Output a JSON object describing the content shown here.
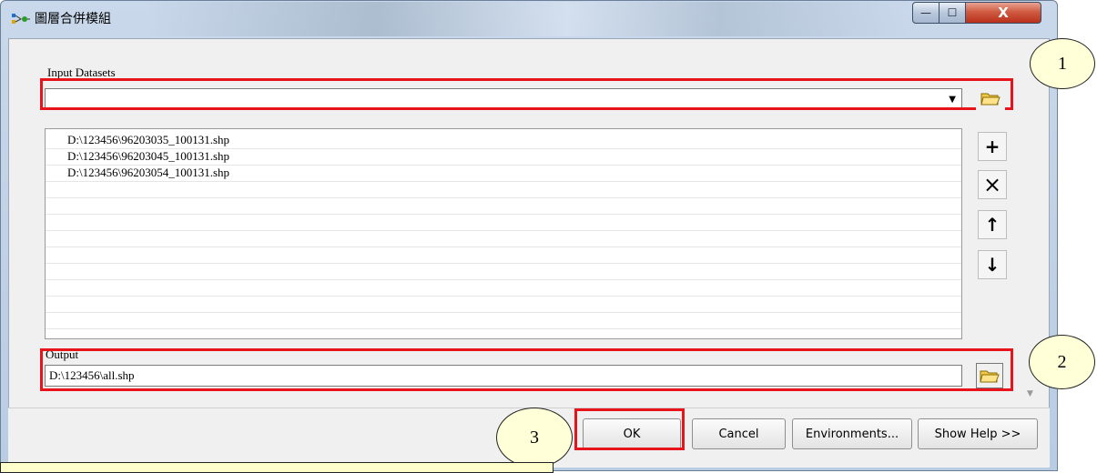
{
  "window": {
    "title": "圖層合併模組",
    "minimize_glyph": "—",
    "maximize_glyph": "☐",
    "close_glyph": "X"
  },
  "input_datasets": {
    "label": "Input Datasets",
    "combo_value": "",
    "dropdown_glyph": "▼",
    "items": [
      "D:\\123456\\96203035_100131.shp",
      "D:\\123456\\96203045_100131.shp",
      "D:\\123456\\96203054_100131.shp"
    ]
  },
  "side_buttons": {
    "add": "+",
    "remove": "×",
    "up": "↑",
    "down": "↓"
  },
  "output": {
    "label": "Output",
    "value": "D:\\123456\\all.shp"
  },
  "buttons": {
    "ok": "OK",
    "cancel": "Cancel",
    "environments": "Environments...",
    "show_help": "Show Help >>"
  },
  "annotations": {
    "callout_1": "1",
    "callout_2": "2",
    "callout_3": "3"
  },
  "colors": {
    "highlight_red": "#e8141c",
    "callout_fill": "#ffffd8"
  }
}
